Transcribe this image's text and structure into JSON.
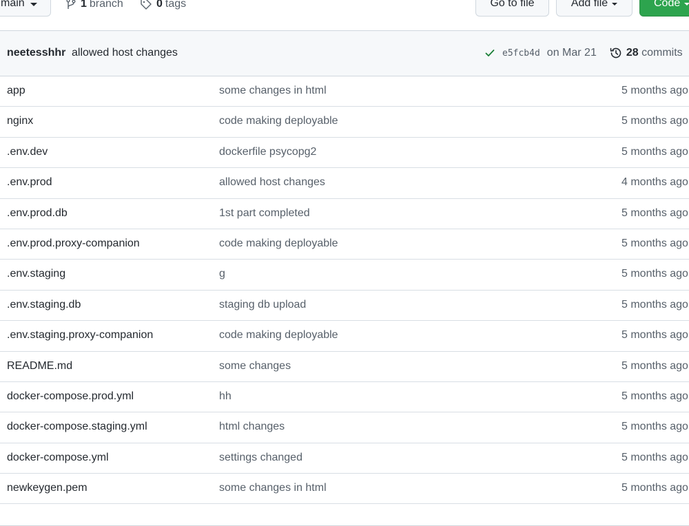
{
  "toolbar": {
    "branch_selector": "main",
    "branch_count": "1",
    "branch_label": "branch",
    "tag_count": "0",
    "tag_label": "tags",
    "go_to_file": "Go to file",
    "add_file": "Add file",
    "code": "Code"
  },
  "latest_commit": {
    "author": "neetesshhr",
    "message": "allowed host changes",
    "sha": "e5fcb4d",
    "date": "on Mar 21",
    "count": "28",
    "count_label": "commits"
  },
  "files": [
    {
      "name": "app",
      "commit": "some changes in html",
      "age": "5 months ago"
    },
    {
      "name": "nginx",
      "commit": "code making deployable",
      "age": "5 months ago"
    },
    {
      "name": ".env.dev",
      "commit": "dockerfile psycopg2",
      "age": "5 months ago"
    },
    {
      "name": ".env.prod",
      "commit": "allowed host changes",
      "age": "4 months ago"
    },
    {
      "name": ".env.prod.db",
      "commit": "1st part completed",
      "age": "5 months ago"
    },
    {
      "name": ".env.prod.proxy-companion",
      "commit": "code making deployable",
      "age": "5 months ago"
    },
    {
      "name": ".env.staging",
      "commit": "g",
      "age": "5 months ago"
    },
    {
      "name": ".env.staging.db",
      "commit": "staging db upload",
      "age": "5 months ago"
    },
    {
      "name": ".env.staging.proxy-companion",
      "commit": "code making deployable",
      "age": "5 months ago"
    },
    {
      "name": "README.md",
      "commit": "some changes",
      "age": "5 months ago"
    },
    {
      "name": "docker-compose.prod.yml",
      "commit": "hh",
      "age": "5 months ago"
    },
    {
      "name": "docker-compose.staging.yml",
      "commit": "html changes",
      "age": "5 months ago"
    },
    {
      "name": "docker-compose.yml",
      "commit": "settings changed",
      "age": "5 months ago"
    },
    {
      "name": "newkeygen.pem",
      "commit": "some changes in html",
      "age": "5 months ago"
    }
  ],
  "icons": {
    "branch": "git-branch-icon",
    "tag": "tag-icon",
    "check": "check-icon",
    "history": "history-icon"
  },
  "colors": {
    "code_button": "#2da44e",
    "check": "#1a7f37",
    "header_bg": "#f6f8fa"
  }
}
